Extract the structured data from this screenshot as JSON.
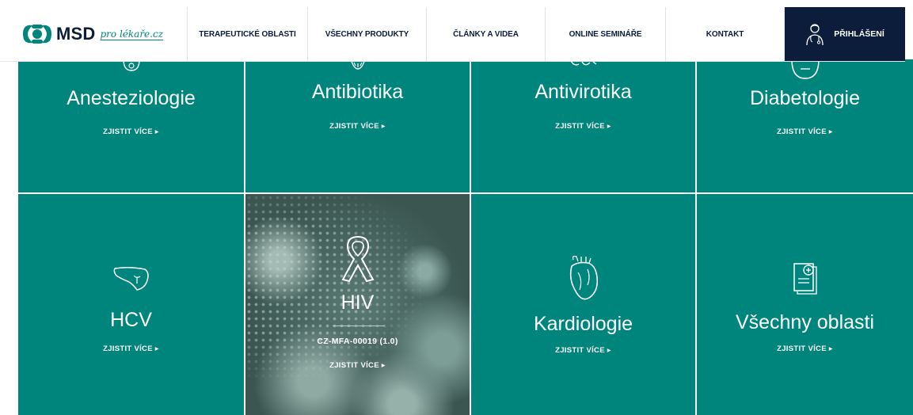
{
  "brand": {
    "name": "MSD",
    "tagline": "pro lékaře.cz"
  },
  "nav": {
    "items": [
      "TERAPEUTICKÉ OBLASTI",
      "VŠECHNY PRODUKTY",
      "ČLÁNKY A VIDEA",
      "ONLINE SEMINÁŘE",
      "KONTAKT"
    ],
    "login": "PŘIHLÁŠENÍ"
  },
  "colors": {
    "tile": "#00857c",
    "navy": "#0b1d3a",
    "white": "#ffffff"
  },
  "tiles": [
    {
      "title": "Anesteziologie",
      "link": "ZJISTIT VÍCE ▸",
      "icon": "anesthesia-icon"
    },
    {
      "title": "Antibiotika",
      "link": "ZJISTIT VÍCE ▸",
      "icon": "antibiotics-icon"
    },
    {
      "title": "Antivirotika",
      "link": "ZJISTIT VÍCE ▸",
      "icon": "antivirals-icon"
    },
    {
      "title": "Diabetologie",
      "link": "ZJISTIT VÍCE ▸",
      "icon": "diabetes-icon"
    },
    {
      "title": "HCV",
      "link": "ZJISTIT VÍCE ▸",
      "icon": "liver-icon"
    },
    {
      "title": "HIV",
      "code": "CZ-MFA-00019 (1.0)",
      "link": "ZJISTIT VÍCE ▸",
      "icon": "ribbon-icon"
    },
    {
      "title": "Kardiologie",
      "link": "ZJISTIT VÍCE ▸",
      "icon": "heart-icon"
    },
    {
      "title": "Všechny oblasti",
      "link": "ZJISTIT VÍCE ▸",
      "icon": "document-icon"
    }
  ]
}
